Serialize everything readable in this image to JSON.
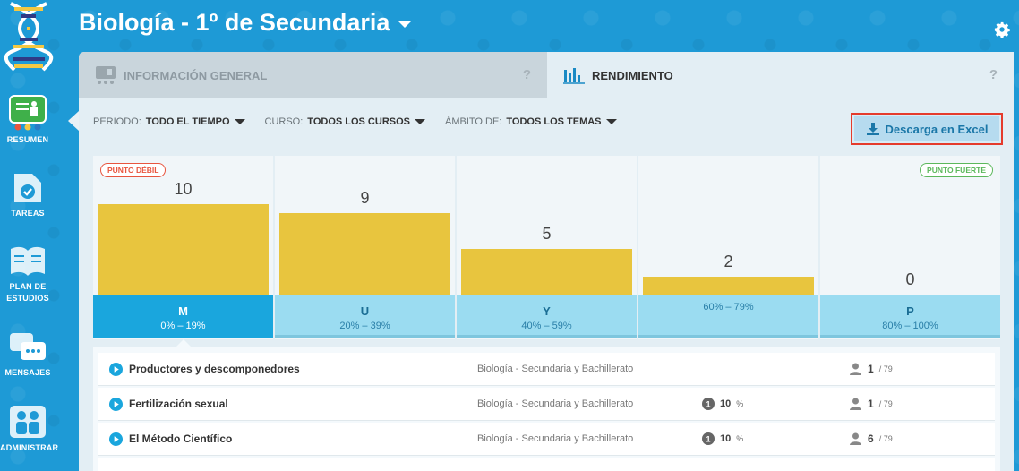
{
  "header": {
    "title": "Biología - 1º de Secundaria"
  },
  "sidebar": {
    "items": [
      {
        "label": "RESUMEN",
        "icon": "presentation-icon",
        "active": true
      },
      {
        "label": "TAREAS",
        "icon": "document-check-icon"
      },
      {
        "label": "PLAN DE ESTUDIOS",
        "icon": "book-icon"
      },
      {
        "label": "MENSAJES",
        "icon": "chat-icon"
      },
      {
        "label": "ADMINISTRAR",
        "icon": "users-icon"
      }
    ]
  },
  "tabs": [
    {
      "label": "INFORMACIÓN GENERAL",
      "help": "?",
      "active": false
    },
    {
      "label": "RENDIMIENTO",
      "help": "?",
      "active": true
    }
  ],
  "filters": [
    {
      "label": "PERIODO:",
      "value": "TODO EL TIEMPO"
    },
    {
      "label": "CURSO:",
      "value": "TODOS LOS CURSOS"
    },
    {
      "label": "ÁMBITO DE:",
      "value": "TODOS LOS TEMAS"
    }
  ],
  "excel_button": {
    "label": "Descarga en Excel"
  },
  "badges": {
    "weak": "PUNTO DÉBIL",
    "strong": "PUNTO FUERTE"
  },
  "chart_data": {
    "type": "bar",
    "categories": [
      "0% – 19%",
      "20% – 39%",
      "40% – 59%",
      "60% – 79%",
      "80% – 100%"
    ],
    "letters": [
      "M",
      "U",
      "Y",
      "",
      "P"
    ],
    "values": [
      10,
      9,
      5,
      2,
      0
    ],
    "ylim": [
      0,
      10
    ],
    "active_index": 0,
    "bar_color": "#e8c53e"
  },
  "topics": [
    {
      "title": "Productores y descomponedores",
      "subject": "Biología - Secundaria y Bachillerato",
      "pct": "",
      "pct_sym": "",
      "pct_badge": "",
      "users": "1",
      "total": "/ 79"
    },
    {
      "title": "Fertilización sexual",
      "subject": "Biología - Secundaria y Bachillerato",
      "pct": "10",
      "pct_sym": "%",
      "pct_badge": "1",
      "users": "1",
      "total": "/ 79"
    },
    {
      "title": "El Método Científico",
      "subject": "Biología - Secundaria y Bachillerato",
      "pct": "10",
      "pct_sym": "%",
      "pct_badge": "1",
      "users": "6",
      "total": "/ 79"
    }
  ],
  "colors": {
    "background": "#1e9ad6",
    "accent": "#1aa6dd",
    "highlight": "#e53b2c"
  }
}
